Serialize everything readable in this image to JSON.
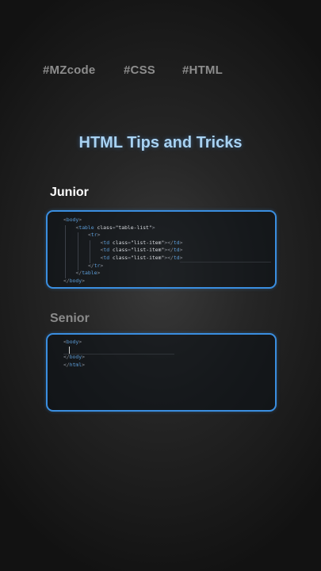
{
  "tags": [
    "#MZcode",
    "#CSS",
    "#HTML"
  ],
  "title": "HTML Tips and Tricks",
  "junior": {
    "label": "Junior",
    "lines": [
      {
        "indent": 0,
        "parts": [
          [
            "pun",
            "<"
          ],
          [
            "tagc",
            "body"
          ],
          [
            "pun",
            ">"
          ]
        ]
      },
      {
        "indent": 1,
        "parts": [
          [
            "pun",
            "<"
          ],
          [
            "tagc",
            "table "
          ],
          [
            "attr",
            "class"
          ],
          [
            "pun",
            "="
          ],
          [
            "str",
            "\"table-list\""
          ],
          [
            "pun",
            ">"
          ]
        ]
      },
      {
        "indent": 2,
        "parts": [
          [
            "pun",
            "<"
          ],
          [
            "tagc",
            "tr"
          ],
          [
            "pun",
            ">"
          ]
        ]
      },
      {
        "indent": 3,
        "parts": [
          [
            "pun",
            "<"
          ],
          [
            "tagc",
            "td "
          ],
          [
            "attr",
            "class"
          ],
          [
            "pun",
            "="
          ],
          [
            "str",
            "\"list-item\""
          ],
          [
            "pun",
            "></"
          ],
          [
            "tagc",
            "td"
          ],
          [
            "pun",
            ">"
          ]
        ]
      },
      {
        "indent": 3,
        "parts": [
          [
            "pun",
            "<"
          ],
          [
            "tagc",
            "td "
          ],
          [
            "attr",
            "class"
          ],
          [
            "pun",
            "="
          ],
          [
            "str",
            "\"list-item\""
          ],
          [
            "pun",
            "></"
          ],
          [
            "tagc",
            "td"
          ],
          [
            "pun",
            ">"
          ]
        ]
      },
      {
        "indent": 3,
        "parts": [
          [
            "pun",
            "<"
          ],
          [
            "tagc",
            "td "
          ],
          [
            "attr",
            "class"
          ],
          [
            "pun",
            "="
          ],
          [
            "str",
            "\"list-item\""
          ],
          [
            "pun",
            "></"
          ],
          [
            "tagc",
            "td"
          ],
          [
            "pun",
            ">"
          ]
        ]
      },
      {
        "indent": 2,
        "parts": [
          [
            "pun",
            "</"
          ],
          [
            "tagc",
            "tr"
          ],
          [
            "pun",
            ">"
          ]
        ]
      },
      {
        "indent": 1,
        "parts": [
          [
            "pun",
            "</"
          ],
          [
            "tagc",
            "table"
          ],
          [
            "pun",
            ">"
          ]
        ]
      },
      {
        "indent": 0,
        "parts": [
          [
            "pun",
            "</"
          ],
          [
            "tagc",
            "body"
          ],
          [
            "pun",
            ">"
          ]
        ]
      }
    ]
  },
  "senior": {
    "label": "Senior",
    "lines": [
      {
        "indent": 0,
        "parts": [
          [
            "pun",
            "<"
          ],
          [
            "tagc",
            "body"
          ],
          [
            "pun",
            ">"
          ]
        ]
      },
      {
        "indent": 0,
        "parts": []
      },
      {
        "indent": 0,
        "parts": [
          [
            "pun",
            "</"
          ],
          [
            "tagc",
            "body"
          ],
          [
            "pun",
            ">"
          ]
        ]
      },
      {
        "indent": 0,
        "parts": [
          [
            "pun",
            "</"
          ],
          [
            "tagc",
            "html"
          ],
          [
            "pun",
            ">"
          ]
        ]
      }
    ]
  },
  "colors": {
    "accent": "#3a8ee0",
    "title": "#a8d2f2",
    "tag_name": "#5c9dd8",
    "punctuation": "#8a8f98",
    "attribute": "#d8dbe0"
  }
}
